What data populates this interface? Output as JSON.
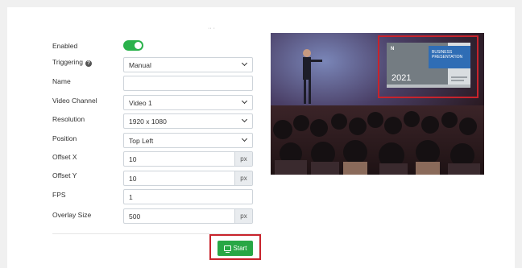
{
  "form": {
    "enabled": {
      "label": "Enabled",
      "value": true
    },
    "triggering": {
      "label": "Triggering",
      "value": "Manual",
      "help_icon": "question-circle-icon"
    },
    "name": {
      "label": "Name",
      "value": ""
    },
    "video_channel": {
      "label": "Video Channel",
      "value": "Video 1"
    },
    "resolution": {
      "label": "Resolution",
      "value": "1920 x 1080"
    },
    "position": {
      "label": "Position",
      "value": "Top Left"
    },
    "offset_x": {
      "label": "Offset X",
      "value": "10",
      "unit": "px"
    },
    "offset_y": {
      "label": "Offset Y",
      "value": "10",
      "unit": "px"
    },
    "fps": {
      "label": "FPS",
      "value": "1"
    },
    "overlay_size": {
      "label": "Overlay Size",
      "value": "500",
      "unit": "px"
    }
  },
  "actions": {
    "start_label": "Start",
    "start_icon": "monitor-icon"
  },
  "preview": {
    "overlay_logo": "N",
    "overlay_title": "BUSINESS PRESENTATION",
    "overlay_year": "2021"
  },
  "colors": {
    "toggle_on": "#2bb24c",
    "start_button": "#28a745",
    "highlight": "#c8232c"
  }
}
